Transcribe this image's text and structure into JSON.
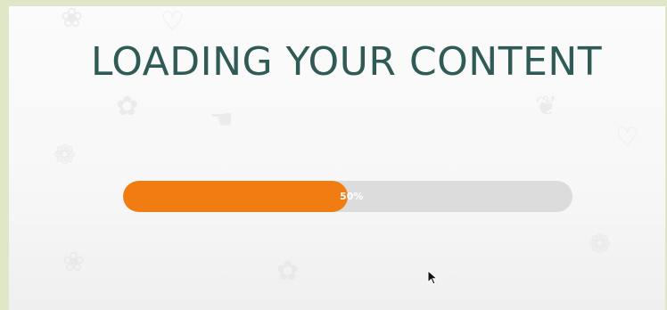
{
  "loading_screen": {
    "title": "LOADING YOUR CONTENT",
    "progress": {
      "value": 0.5,
      "label": "50%"
    }
  },
  "colors": {
    "title": "#2f5a55",
    "progress_fill": "#f07c12",
    "progress_track": "#dcdcdc",
    "outer_frame": "#dfe7c8"
  },
  "icons": {
    "cursor": "mouse-pointer-icon"
  }
}
